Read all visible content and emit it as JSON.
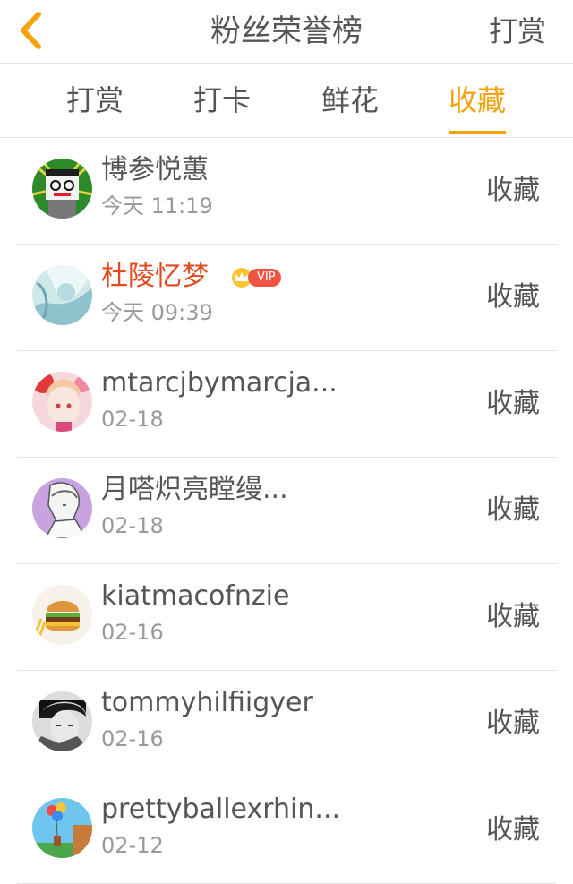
{
  "header": {
    "title": "粉丝荣誉榜",
    "action_label": "打赏",
    "back_icon": "chevron-left-icon",
    "back_color": "#f5a20c"
  },
  "tabs": [
    {
      "label": "打赏",
      "active": false
    },
    {
      "label": "打卡",
      "active": false
    },
    {
      "label": "鲜花",
      "active": false
    },
    {
      "label": "收藏",
      "active": true
    }
  ],
  "accent_color": "#f5a20c",
  "vip_name_color": "#e24a1e",
  "fans": [
    {
      "name": "博参悦蕙",
      "time": "今天 11:19",
      "action": "收藏",
      "vip": false
    },
    {
      "name": "杜陵忆梦",
      "time": "今天 09:39",
      "action": "收藏",
      "vip": true,
      "vip_label": "VIP"
    },
    {
      "name": "mtarcjbymarcja...",
      "time": "02-18",
      "action": "收藏",
      "vip": false
    },
    {
      "name": "月嗒炽亮瞠缦...",
      "time": "02-18",
      "action": "收藏",
      "vip": false
    },
    {
      "name": "kiatmacofnzie",
      "time": "02-16",
      "action": "收藏",
      "vip": false
    },
    {
      "name": "tommyhilfiigyer",
      "time": "02-16",
      "action": "收藏",
      "vip": false
    },
    {
      "name": "prettyballexrhin...",
      "time": "02-12",
      "action": "收藏",
      "vip": false
    }
  ]
}
